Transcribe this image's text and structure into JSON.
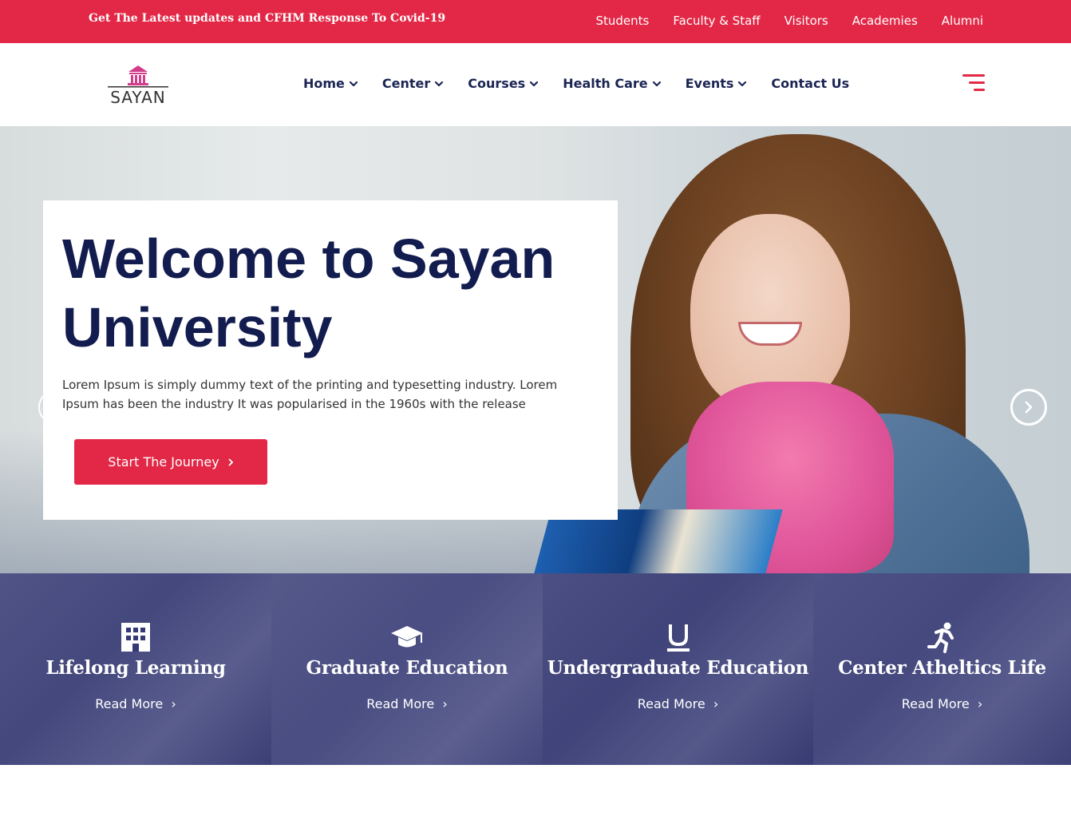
{
  "topbar": {
    "notice": "Get The Latest updates and CFHM Response To Covid-19",
    "links": [
      "Students",
      "Faculty & Staff",
      "Visitors",
      "Academies",
      "Alumni"
    ]
  },
  "brand": {
    "name": "SAYAN"
  },
  "nav": {
    "items": [
      {
        "label": "Home",
        "has_dropdown": true
      },
      {
        "label": "Center",
        "has_dropdown": true
      },
      {
        "label": "Courses",
        "has_dropdown": true
      },
      {
        "label": "Health Care",
        "has_dropdown": true
      },
      {
        "label": "Events",
        "has_dropdown": true
      },
      {
        "label": "Contact Us",
        "has_dropdown": false
      }
    ],
    "menu_icon": "hamburger-menu-icon"
  },
  "hero": {
    "title": "Welcome to Sayan University",
    "body": "Lorem Ipsum is simply dummy text of the printing and typesetting industry. Lorem Ipsum has been the industry It was popularised in the 1960s with the release",
    "cta_label": "Start The Journey",
    "next_icon": "chevron-right-circle-icon"
  },
  "features": [
    {
      "title": "Lifelong Learning",
      "link": "Read More",
      "icon": "building-icon"
    },
    {
      "title": "Graduate Education",
      "link": "Read More",
      "icon": "graduation-cap-icon"
    },
    {
      "title": "Undergraduate Education",
      "link": "Read More",
      "icon": "underline-u-icon"
    },
    {
      "title": "Center Atheltics Life",
      "link": "Read More",
      "icon": "running-person-icon"
    }
  ],
  "colors": {
    "accent": "#e22846",
    "navy": "#121c4e",
    "overlay": "#282d6e"
  }
}
